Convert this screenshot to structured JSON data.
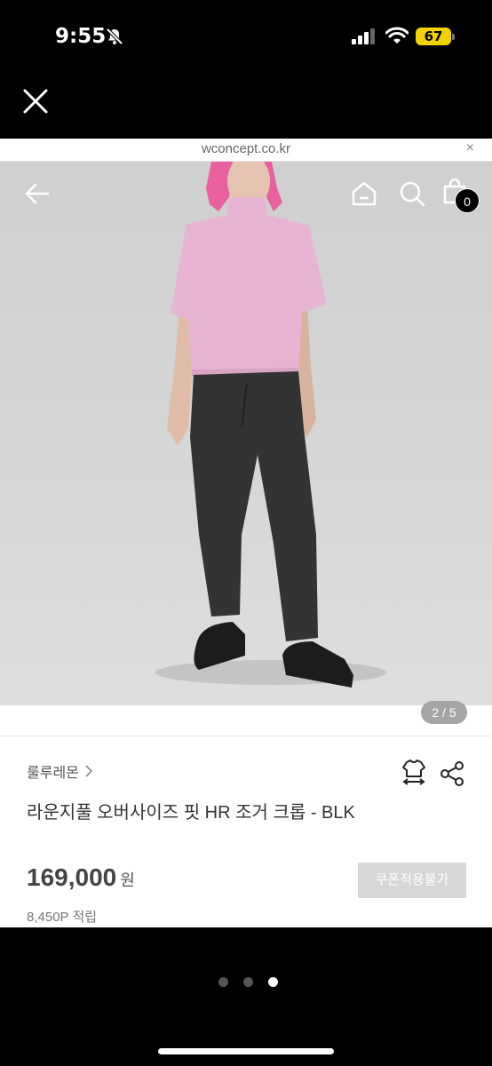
{
  "status_bar": {
    "time": "9:55",
    "battery": "67",
    "icons": [
      "bell-slash-icon",
      "signal-icon",
      "wifi-icon",
      "battery-icon"
    ]
  },
  "browser": {
    "url": "wconcept.co.kr",
    "close_label": "×"
  },
  "header": {
    "icons": [
      "back-arrow-icon",
      "home-icon",
      "search-icon",
      "shopping-bag-icon"
    ],
    "cart_count": "0"
  },
  "gallery": {
    "page_indicator": "2 / 5"
  },
  "product": {
    "brand": "룰루레몬",
    "title": "라운지풀 오버사이즈 핏 HR 조거 크롭 - BLK",
    "price": "169,000",
    "currency": "원",
    "coupon_label": "쿠폰적용불가",
    "points": "8,450P 적립"
  },
  "carousel": {
    "current_index": 3,
    "total": 3
  },
  "colors": {
    "image_background": "#d3d3d3",
    "shirt": "#e7b5d3",
    "pants": "#333333",
    "hair": "#e8609e",
    "battery": "#f2d300"
  }
}
